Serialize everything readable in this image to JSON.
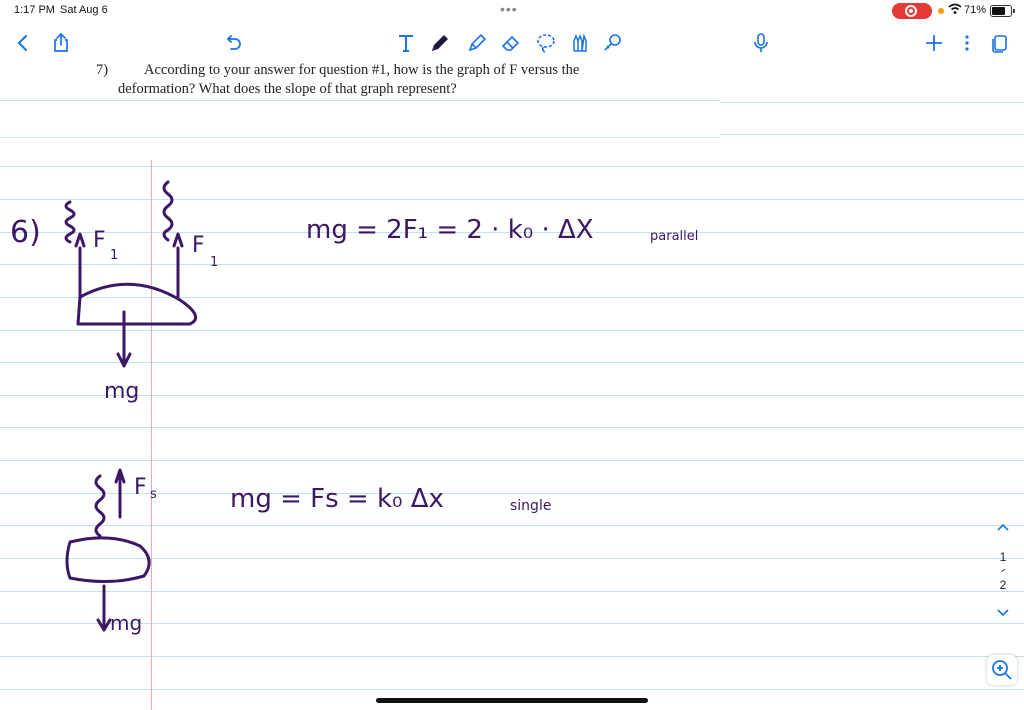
{
  "status_bar": {
    "time": "1:17 PM",
    "date": "Sat Aug 6",
    "multitask_dots": "•••",
    "battery_percent": "71%",
    "battery_level": 0.71,
    "recording_color": "#e53935"
  },
  "toolbar": {
    "left_icons": [
      "chevron-left-icon",
      "share-icon",
      "undo-icon"
    ],
    "tools": [
      "text-tool-icon",
      "pen-icon",
      "highlighter-icon",
      "eraser-icon",
      "lasso-icon",
      "shapes-icon",
      "elements-icon"
    ],
    "right_icons": [
      "microphone-icon",
      "add-page-icon",
      "more-icon",
      "pages-icon"
    ],
    "ink_color": "#3b1866"
  },
  "document": {
    "question": {
      "number": "7)",
      "line1": "According to your answer for question #1, how is the graph of F versus the",
      "line2": "deformation? What does the slope of that graph represent?"
    },
    "ruled_line_color": "#bfe4ee",
    "margin_line_color": "#f4a6b5"
  },
  "handwriting": {
    "problem_label": "6)",
    "force_label_left": "F",
    "force_sub_left": "1",
    "force_label_right": "F",
    "force_sub_right": "1",
    "weight_label_top": "mg",
    "equation_parallel": "mg = 2F₁ = 2 · k₀ · ΔX",
    "equation_parallel_sub": "parallel",
    "force_label_spring": "F",
    "force_sub_spring": "s",
    "equation_single": "mg = Fs = k₀ Δx",
    "equation_single_sub": "single",
    "weight_label_bottom": "mg"
  },
  "pagination": {
    "current": "1",
    "total": "2"
  }
}
